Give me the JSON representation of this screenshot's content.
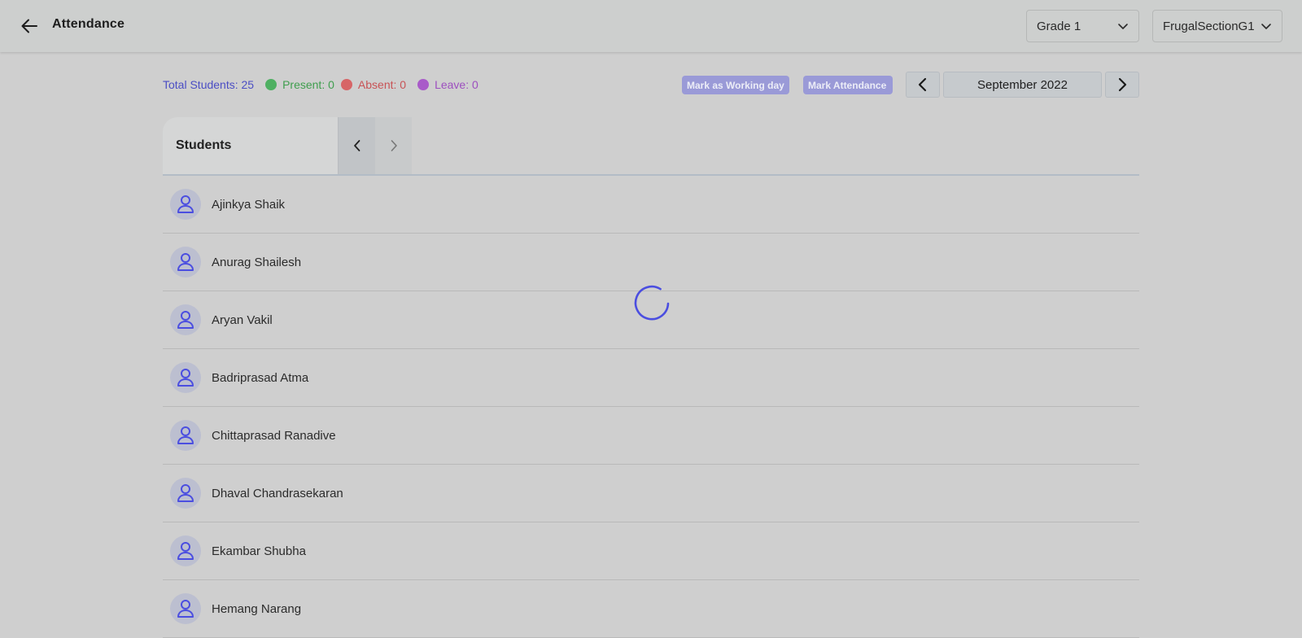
{
  "header": {
    "title": "Attendance",
    "grade_select": "Grade 1",
    "section_select": "FrugalSectionG1"
  },
  "stats": {
    "total": "Total Students: 25",
    "present": "Present: 0",
    "absent": "Absent: 0",
    "leave": "Leave: 0"
  },
  "actions": {
    "mark_working_day": "Mark as Working day",
    "mark_attendance": "Mark Attendance"
  },
  "calendar": {
    "month": "September 2022"
  },
  "table": {
    "header": "Students",
    "students": [
      "Ajinkya Shaik",
      "Anurag Shailesh",
      "Aryan Vakil",
      "Badriprasad Atma",
      "Chittaprasad Ranadive",
      "Dhaval Chandrasekaran",
      "Ekambar Shubha",
      "Hemang Narang"
    ]
  },
  "colors": {
    "accent": "#4b4ec4",
    "present": "#3f9e4e",
    "absent": "#c85356",
    "leave": "#9d4fbf"
  },
  "icons": [
    "back-arrow-icon",
    "chevron-down-icon",
    "chevron-left-icon",
    "chevron-right-icon",
    "user-icon",
    "loading-spinner-icon"
  ]
}
